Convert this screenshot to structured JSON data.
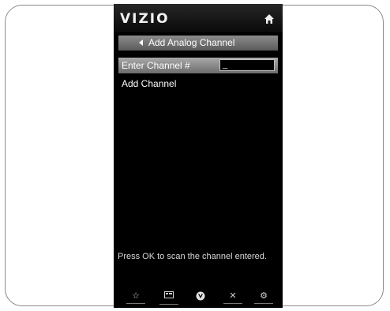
{
  "screen": {
    "brand": "VIZIO",
    "header_title": "Add Analog Channel",
    "menu": {
      "enter_channel_label": "Enter Channel #",
      "channel_input_value": "_",
      "add_channel_label": "Add Channel"
    },
    "help_text": "Press OK to scan the channel entered.",
    "footer_icons": [
      "star-icon",
      "widget-icon",
      "v-logo-icon",
      "close-icon",
      "settings-icon"
    ]
  }
}
